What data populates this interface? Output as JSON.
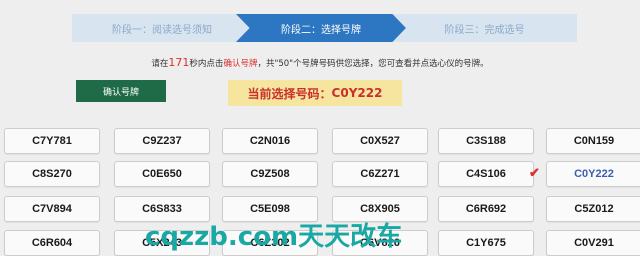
{
  "steps": [
    {
      "label": "阶段一：阅读选号须知"
    },
    {
      "label": "阶段二：选择号牌"
    },
    {
      "label": "阶段三：完成选号"
    }
  ],
  "instruction": {
    "prefix": "请在",
    "seconds": "171",
    "mid1": "秒内点击",
    "link": "确认号牌",
    "suffix": "，共\"50\"个号牌号码供您选择，您可查看并点选心仪的号牌。"
  },
  "confirm_button": "确认号牌",
  "current": {
    "label": "当前选择号码：",
    "value": "C0Y222"
  },
  "plates": [
    [
      "C7Y781",
      "C9Z237",
      "C2N016",
      "C0X527",
      "C3S188",
      "C0N159"
    ],
    [
      "C8S270",
      "C0E650",
      "C9Z508",
      "C6Z271",
      "C4S106",
      "C0Y222"
    ],
    [
      "C7V894",
      "C6S833",
      "C5E098",
      "C8X905",
      "C6R692",
      "C5Z012"
    ],
    [
      "C6R604",
      "C5X243",
      "C6Z302",
      "C6V826",
      "C1Y675",
      "C0V291"
    ]
  ],
  "selected_plate": "C0Y222",
  "watermark": "cqzzb.com天天改车",
  "colors": {
    "active_step": "#2d76c1",
    "confirm_button": "#1f6b47",
    "highlight": "#d9312b",
    "watermark": "#1aa8a4"
  }
}
